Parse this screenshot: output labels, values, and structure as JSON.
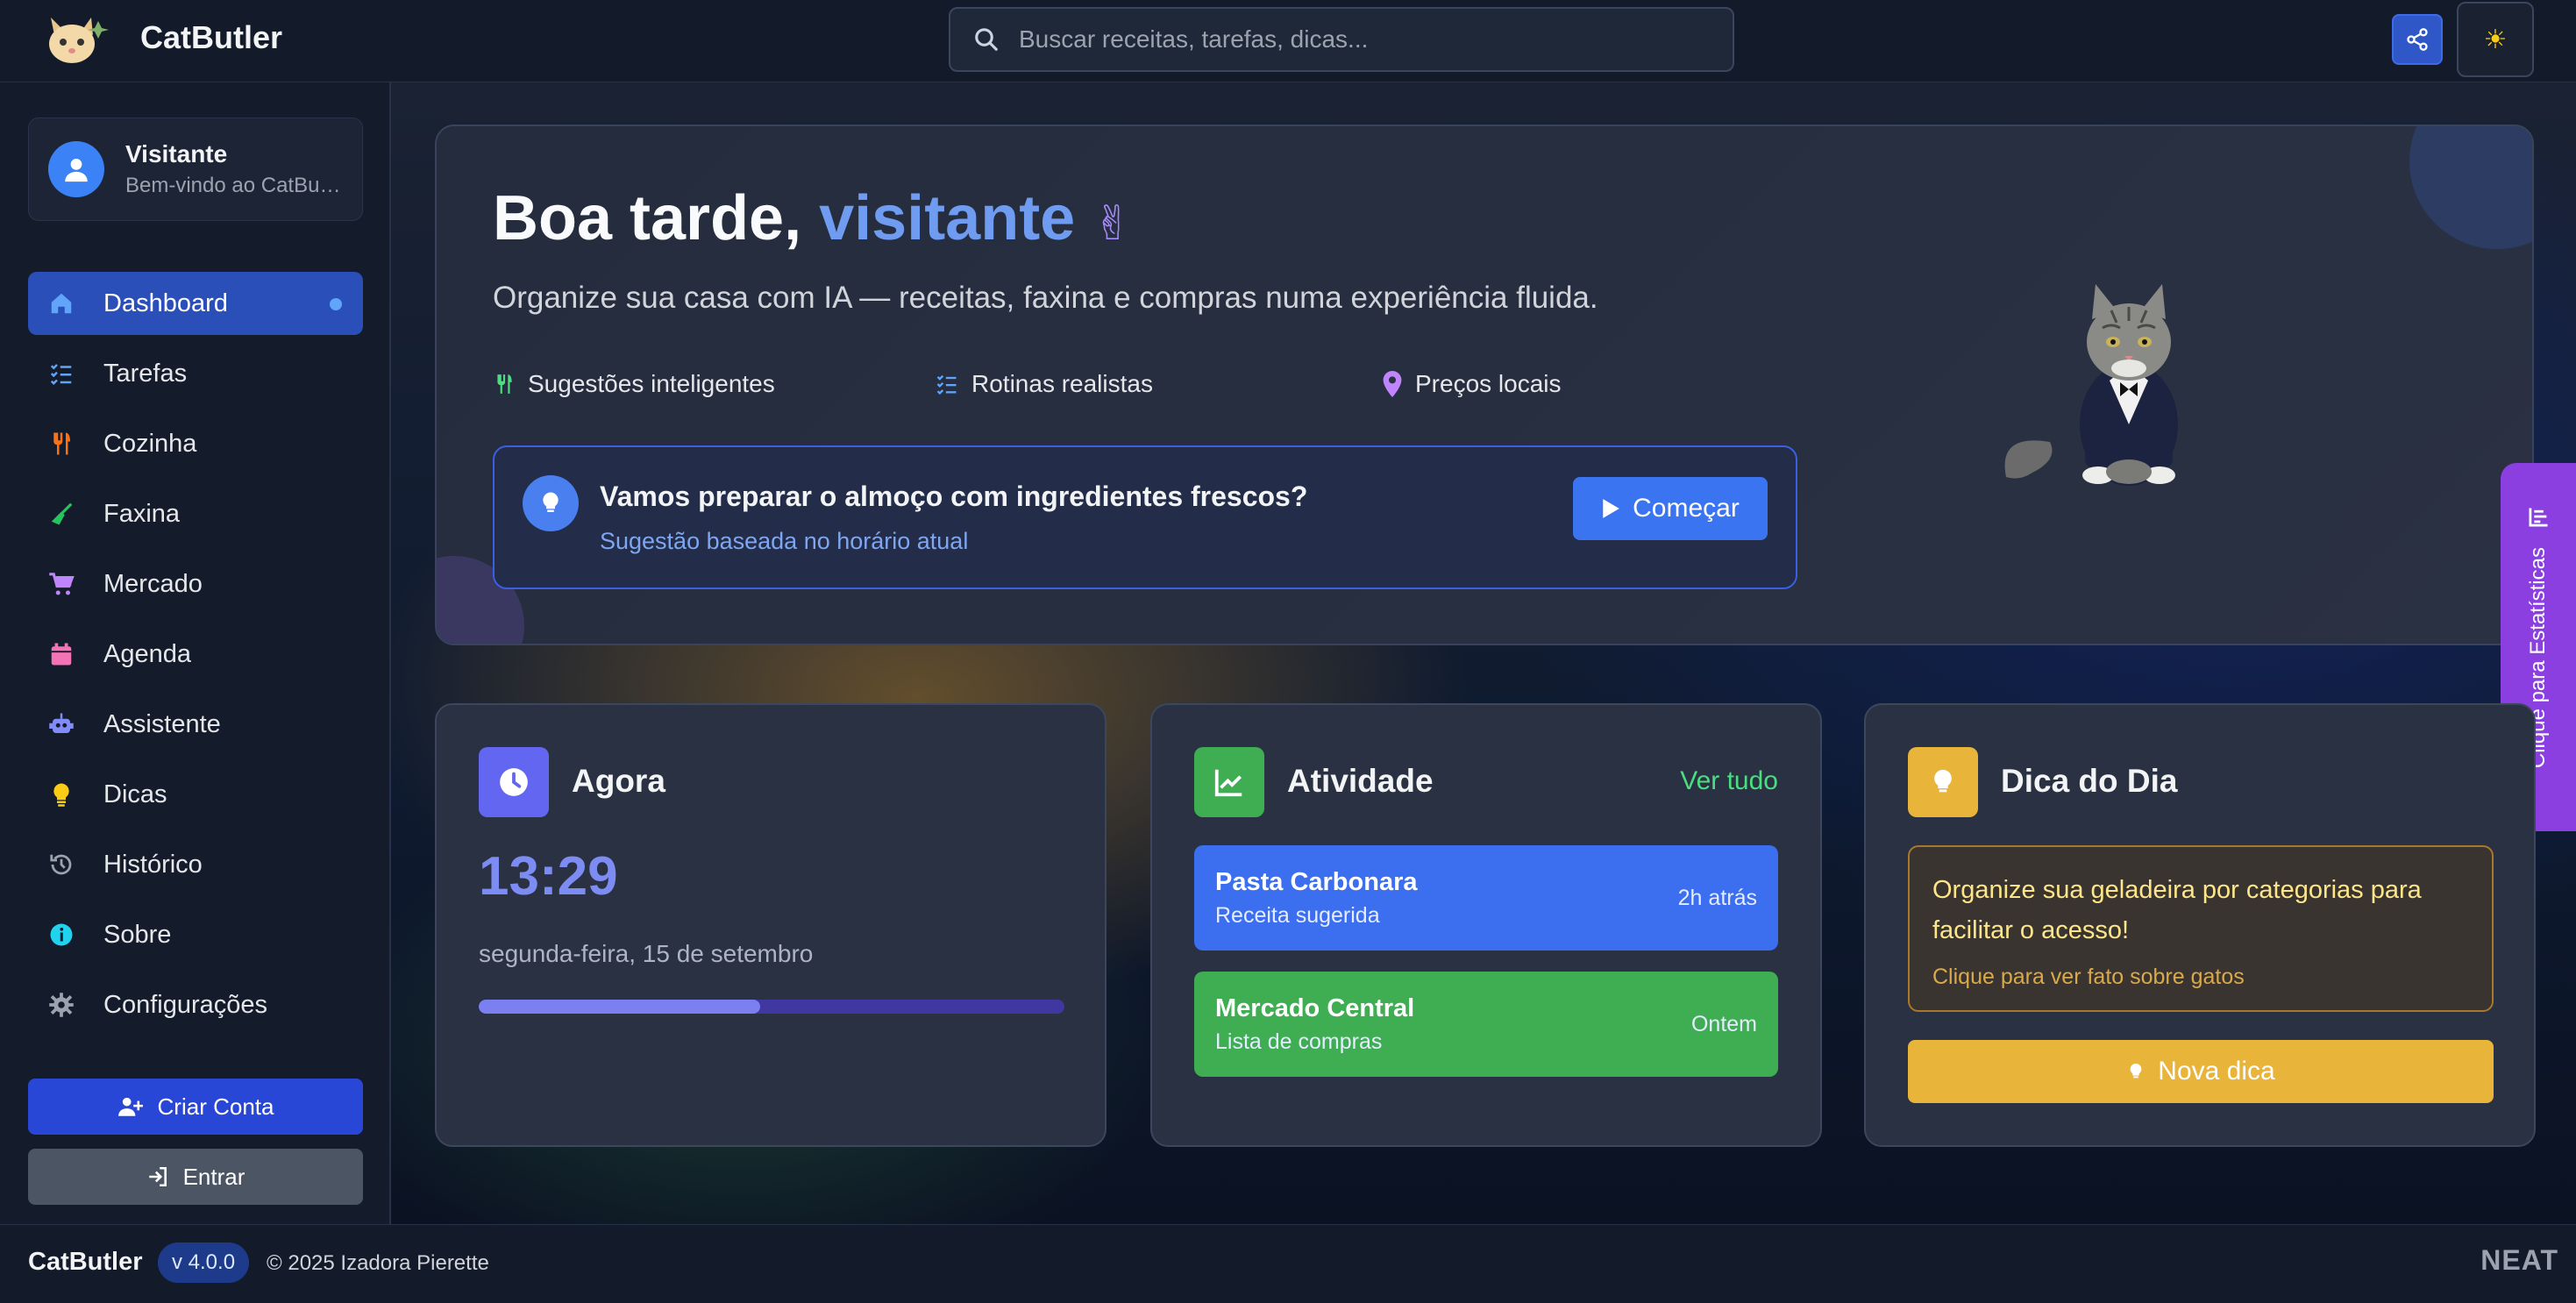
{
  "header": {
    "brand": "CatButler",
    "search_placeholder": "Buscar receitas, tarefas, dicas...",
    "theme_icon": "☀"
  },
  "user": {
    "name": "Visitante",
    "welcome": "Bem-vindo ao CatButler"
  },
  "nav": [
    {
      "label": "Dashboard",
      "icon": "home-icon",
      "color": "#60a5fa",
      "active": true
    },
    {
      "label": "Tarefas",
      "icon": "list-check-icon",
      "color": "#60a5fa"
    },
    {
      "label": "Cozinha",
      "icon": "utensils-icon",
      "color": "#f97316"
    },
    {
      "label": "Faxina",
      "icon": "broom-icon",
      "color": "#22c55e"
    },
    {
      "label": "Mercado",
      "icon": "cart-icon",
      "color": "#c084fc"
    },
    {
      "label": "Agenda",
      "icon": "calendar-icon",
      "color": "#f472b6"
    },
    {
      "label": "Assistente",
      "icon": "robot-icon",
      "color": "#818cf8"
    },
    {
      "label": "Dicas",
      "icon": "lightbulb-icon",
      "color": "#facc15"
    },
    {
      "label": "Histórico",
      "icon": "history-icon",
      "color": "#9ca3af"
    },
    {
      "label": "Sobre",
      "icon": "info-icon",
      "color": "#22d3ee"
    },
    {
      "label": "Configurações",
      "icon": "gear-icon",
      "color": "#9ca3af"
    }
  ],
  "sidebar_buttons": {
    "create": "Criar Conta",
    "login": "Entrar"
  },
  "hero": {
    "greeting": "Boa tarde, ",
    "greeting_name": "visitante",
    "subtitle": "Organize sua casa com IA — receitas, faxina e compras numa experiência fluida.",
    "features": [
      "Sugestões inteligentes",
      "Rotinas realistas",
      "Preços locais"
    ],
    "suggestion_title": "Vamos preparar o almoço com ingredientes frescos?",
    "suggestion_sub": "Sugestão baseada no horário atual",
    "start_label": "Começar"
  },
  "stats_tab": "Clique para Estatísticas",
  "now_card": {
    "title": "Agora",
    "time": "13:29",
    "date": "segunda-feira, 15 de setembro",
    "progress": 0.48
  },
  "activity_card": {
    "title": "Atividade",
    "see_all": "Ver tudo",
    "items": [
      {
        "title": "Pasta Carbonara",
        "sub": "Receita sugerida",
        "time": "2h atrás",
        "color": "#3b6ff0"
      },
      {
        "title": "Mercado Central",
        "sub": "Lista de compras",
        "time": "Ontem",
        "color": "#3fae52"
      }
    ]
  },
  "tip_card": {
    "title": "Dica do Dia",
    "text": "Organize sua geladeira por categorias para facilitar o acesso!",
    "hint": "Clique para ver fato sobre gatos",
    "button": "Nova dica"
  },
  "footer": {
    "brand": "CatButler",
    "version": "v 4.0.0",
    "copyright": "© 2025 Izadora Pierette",
    "badge": "NEAT"
  }
}
